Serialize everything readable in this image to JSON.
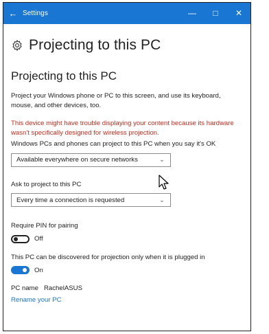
{
  "window": {
    "title": "Settings",
    "back_glyph": "←",
    "minimize_glyph": "—",
    "maximize_glyph": "□",
    "close_glyph": "✕",
    "accent_color": "#1976d2"
  },
  "header": {
    "icon": "gear-icon",
    "title": "Projecting to this PC"
  },
  "section": {
    "title": "Projecting to this PC",
    "description": "Project your Windows phone or PC to this screen, and use its keyboard, mouse, and other devices, too.",
    "warning": "This device might have trouble displaying your content because its hardware wasn't specifically designed for wireless projection.",
    "warning_color": "#c42b1c"
  },
  "availability": {
    "label": "Windows PCs and phones can project to this PC when you say it's OK",
    "selected": "Available everywhere on secure networks"
  },
  "ask": {
    "label": "Ask to project to this PC",
    "selected": "Every time a connection is requested"
  },
  "pin": {
    "label": "Require PIN for pairing",
    "state": "Off"
  },
  "plugged": {
    "label": "This PC can be discovered for projection only when it is plugged in",
    "state": "On"
  },
  "pc": {
    "name_label": "PC name",
    "name_value": "RachelASUS",
    "rename_link": "Rename your PC"
  }
}
